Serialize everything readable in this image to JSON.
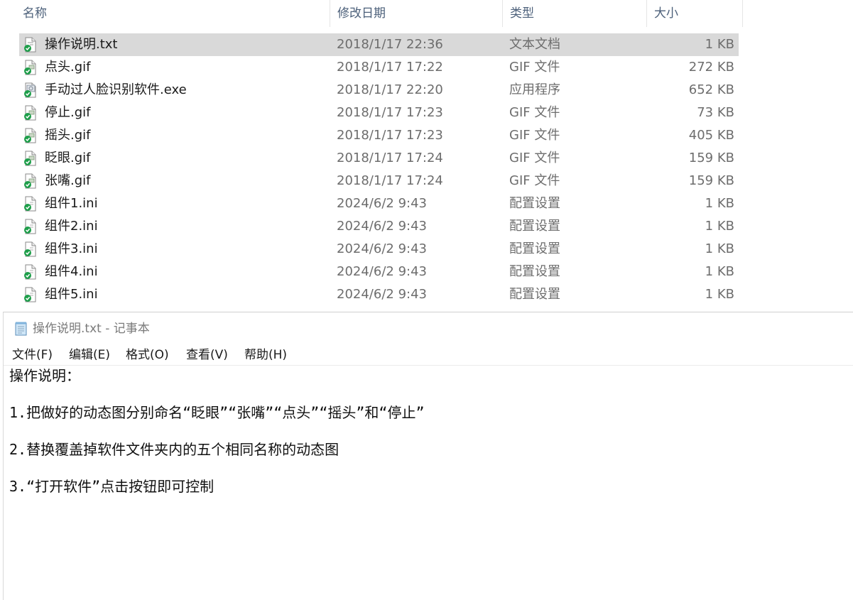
{
  "explorer": {
    "columns": {
      "name": "名称",
      "date": "修改日期",
      "type": "类型",
      "size": "大小"
    },
    "files": [
      {
        "name": "操作说明.txt",
        "date": "2018/1/17 22:36",
        "type": "文本文档",
        "size": "1 KB",
        "icon": "text-file-icon"
      },
      {
        "name": "点头.gif",
        "date": "2018/1/17 17:22",
        "type": "GIF 文件",
        "size": "272 KB",
        "icon": "image-file-icon"
      },
      {
        "name": "手动过人脸识别软件.exe",
        "date": "2018/1/17 22:20",
        "type": "应用程序",
        "size": "652 KB",
        "icon": "exe-file-icon"
      },
      {
        "name": "停止.gif",
        "date": "2018/1/17 17:23",
        "type": "GIF 文件",
        "size": "73 KB",
        "icon": "image-file-icon"
      },
      {
        "name": "摇头.gif",
        "date": "2018/1/17 17:23",
        "type": "GIF 文件",
        "size": "405 KB",
        "icon": "image-file-icon"
      },
      {
        "name": "眨眼.gif",
        "date": "2018/1/17 17:24",
        "type": "GIF 文件",
        "size": "159 KB",
        "icon": "image-file-icon"
      },
      {
        "name": "张嘴.gif",
        "date": "2018/1/17 17:24",
        "type": "GIF 文件",
        "size": "159 KB",
        "icon": "image-file-icon"
      },
      {
        "name": "组件1.ini",
        "date": "2024/6/2 9:43",
        "type": "配置设置",
        "size": "1 KB",
        "icon": "ini-file-icon"
      },
      {
        "name": "组件2.ini",
        "date": "2024/6/2 9:43",
        "type": "配置设置",
        "size": "1 KB",
        "icon": "ini-file-icon"
      },
      {
        "name": "组件3.ini",
        "date": "2024/6/2 9:43",
        "type": "配置设置",
        "size": "1 KB",
        "icon": "ini-file-icon"
      },
      {
        "name": "组件4.ini",
        "date": "2024/6/2 9:43",
        "type": "配置设置",
        "size": "1 KB",
        "icon": "ini-file-icon"
      },
      {
        "name": "组件5.ini",
        "date": "2024/6/2 9:43",
        "type": "配置设置",
        "size": "1 KB",
        "icon": "ini-file-icon"
      }
    ]
  },
  "notepad": {
    "title": "操作说明.txt - 记事本",
    "menu": [
      "文件(F)",
      "编辑(E)",
      "格式(O)",
      "查看(V)",
      "帮助(H)"
    ],
    "content": [
      "操作说明：",
      "1.把做好的动态图分别命名“眨眼”“张嘴”“点头”“摇头”和“停止”",
      "2.替换覆盖掉软件文件夹内的五个相同名称的动态图",
      "3.“打开软件”点击按钮即可控制"
    ]
  },
  "colors": {
    "selected_row": "#d9d9d9",
    "sync_badge": "#1e9e4a",
    "header_text": "#4c607a"
  }
}
